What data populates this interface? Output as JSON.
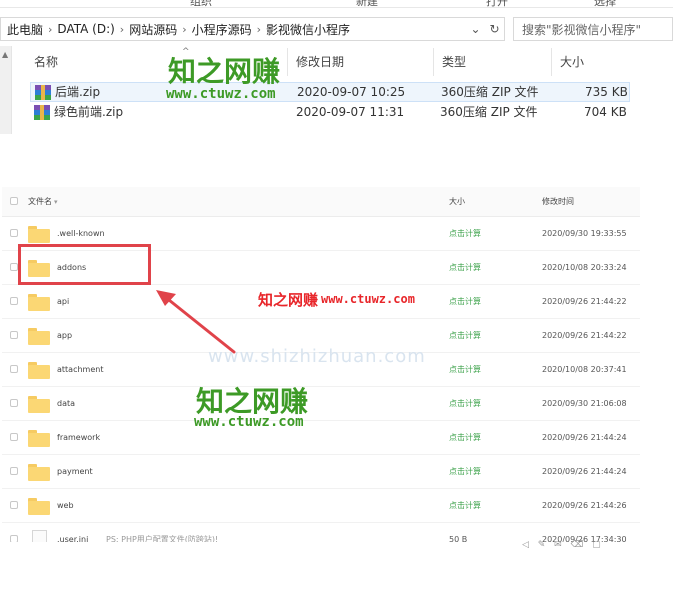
{
  "explorer": {
    "ribbon": {
      "tab_organize": "组织",
      "tab_new": "新建",
      "tab_open": "打开",
      "tab_select": "选择"
    },
    "breadcrumb": [
      "此电脑",
      "DATA (D:)",
      "网站源码",
      "小程序源码",
      "影视微信小程序"
    ],
    "search_placeholder": "搜索\"影视微信小程序\"",
    "columns": {
      "name": "名称",
      "modified": "修改日期",
      "type": "类型",
      "size": "大小"
    },
    "files": [
      {
        "name": "后端.zip",
        "modified": "2020-09-07 10:25",
        "type": "360压缩 ZIP 文件",
        "size": "735 KB"
      },
      {
        "name": "绿色前端.zip",
        "modified": "2020-09-07 11:31",
        "type": "360压缩 ZIP 文件",
        "size": "704 KB"
      }
    ]
  },
  "file_manager": {
    "header": {
      "name": "文件名",
      "size": "大小",
      "modified": "修改时间"
    },
    "rows": [
      {
        "name": ".well-known",
        "size": "点击计算",
        "modified": "2020/09/30 19:33:55"
      },
      {
        "name": "addons",
        "size": "点击计算",
        "modified": "2020/10/08 20:33:24"
      },
      {
        "name": "api",
        "size": "点击计算",
        "modified": "2020/09/26 21:44:22"
      },
      {
        "name": "app",
        "size": "点击计算",
        "modified": "2020/09/26 21:44:22"
      },
      {
        "name": "attachment",
        "size": "点击计算",
        "modified": "2020/10/08 20:37:41"
      },
      {
        "name": "data",
        "size": "点击计算",
        "modified": "2020/09/30 21:06:08"
      },
      {
        "name": "framework",
        "size": "点击计算",
        "modified": "2020/09/26 21:44:24"
      },
      {
        "name": "payment",
        "size": "点击计算",
        "modified": "2020/09/26 21:44:24"
      },
      {
        "name": "web",
        "size": "点击计算",
        "modified": "2020/09/26 21:44:26"
      },
      {
        "name": ".user.ini",
        "note": "PS: PHP用户配置文件(防跨站)!",
        "size": "50 B",
        "modified": "2020/09/26 17:34:30"
      }
    ]
  },
  "watermarks": {
    "brand_cn": "知之网赚",
    "brand_url": "www.ctuwz.com",
    "faint_url": "www.shizhizhuan.com",
    "red_cn": "知之网赚",
    "red_url": "www.ctuwz.com"
  },
  "colors": {
    "brand_green": "#3d9a26",
    "annotation_red": "#e0434a",
    "calc_link_green": "#3fa34d",
    "selection": "#eef5fc"
  }
}
